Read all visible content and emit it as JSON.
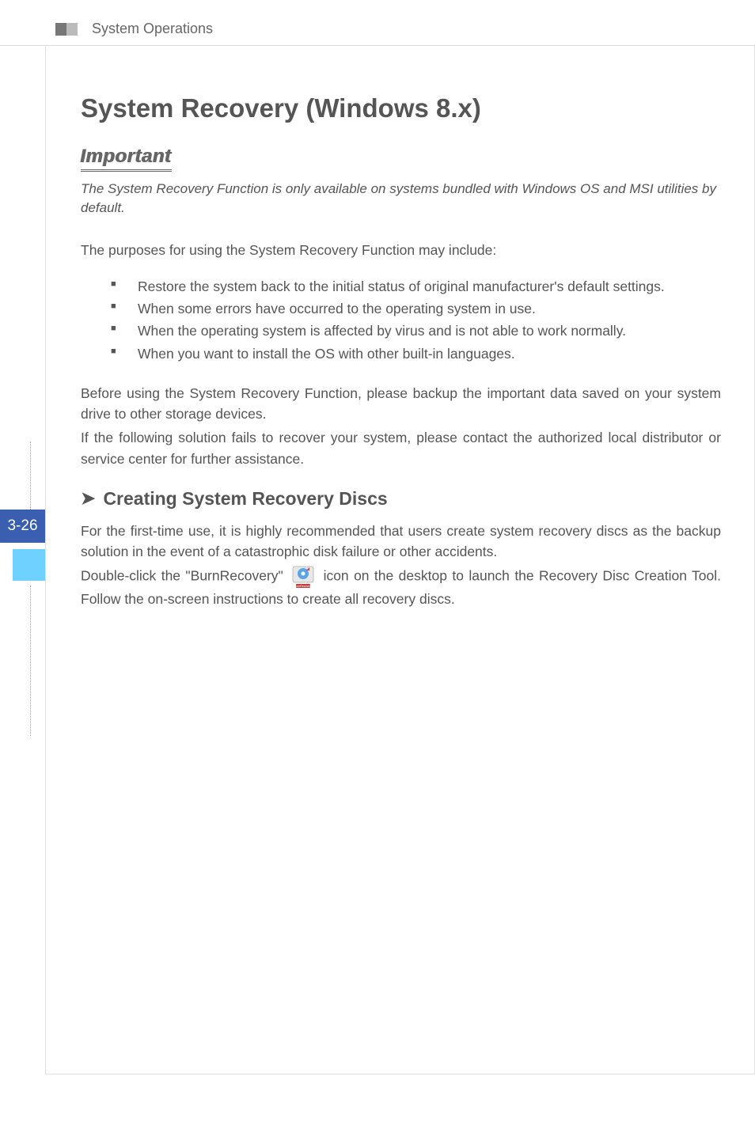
{
  "header": {
    "section_title": "System Operations"
  },
  "page": {
    "number": "3-26"
  },
  "content": {
    "main_heading": "System Recovery (Windows 8.x)",
    "important_label": "Important",
    "important_note": "The System Recovery Function is only available on systems bundled with Windows OS and MSI utilities by default.",
    "intro_text": "The purposes for using the System Recovery Function may include:",
    "bullets": [
      "Restore the system back to the initial status of original manufacturer's default settings.",
      "When some errors have occurred to the operating system in use.",
      "When the operating system is affected by virus and is not able to work normally.",
      "When you want to install the OS with other built-in languages."
    ],
    "before_using_text": "Before using the System Recovery Function, please backup the important data saved on your system drive to other storage devices.",
    "fallback_text": "If the following solution fails to recover your system, please contact the authorized local distributor or service center for further assistance.",
    "sub_heading": "Creating System Recovery Discs",
    "first_time_text": "For the first-time use, it is highly recommended that users create system recovery discs as the backup solution in the event of a catastrophic disk failure or other accidents.",
    "double_click_prefix": "Double-click the \"BurnRecovery\"",
    "double_click_suffix": " icon on the desktop to launch the Recovery Disc Creation Tool. Follow the on-screen instructions to create all recovery discs."
  }
}
